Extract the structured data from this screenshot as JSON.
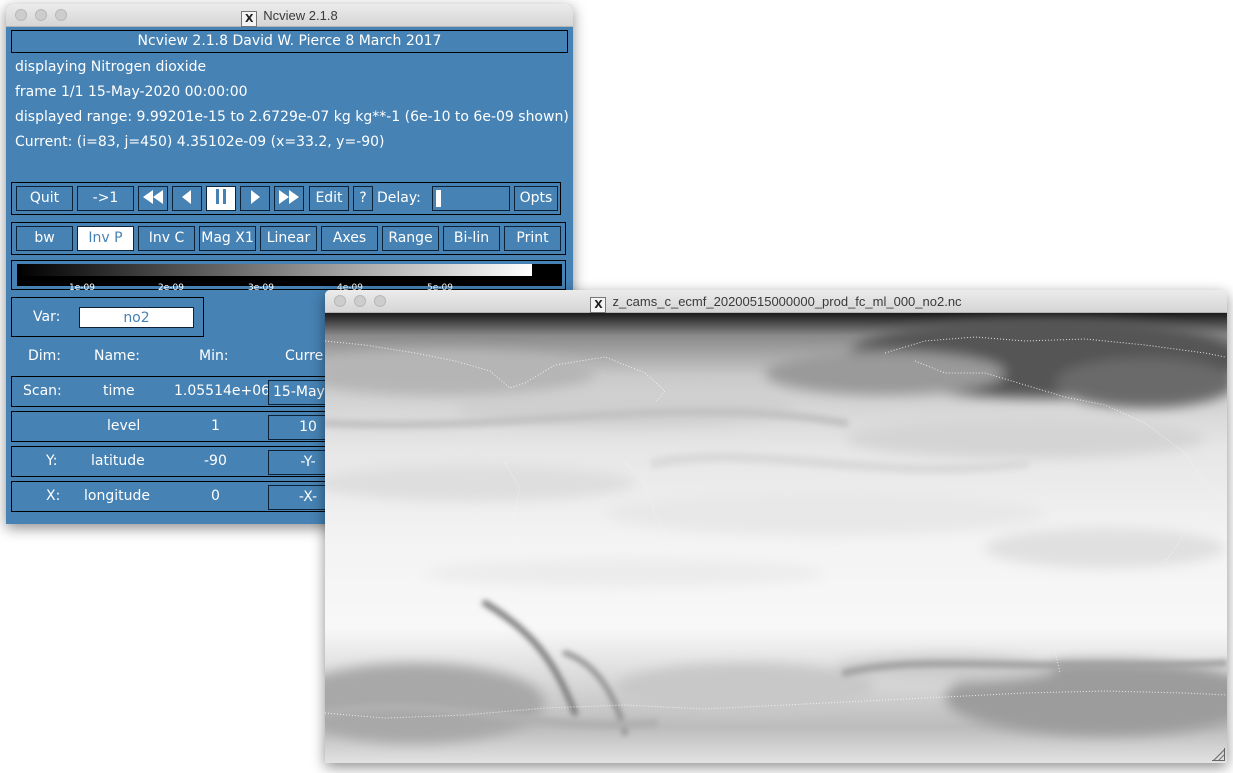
{
  "control_window": {
    "title": "Ncview 2.1.8",
    "banner": "Ncview 2.1.8 David W. Pierce  8 March 2017",
    "info": {
      "displaying": "displaying Nitrogen dioxide",
      "frame": "frame 1/1 15-May-2020 00:00:00",
      "range": "displayed range: 9.99201e-15 to 2.6729e-07 kg kg**-1 (6e-10 to 6e-09 shown)",
      "current": "Current: (i=83, j=450) 4.35102e-09 (x=33.2, y=-90)"
    },
    "buttons_row1": {
      "quit": "Quit",
      "restart": "->1",
      "edit": "Edit",
      "help": "?",
      "delay_label": "Delay:",
      "opts": "Opts"
    },
    "buttons_row2": {
      "bw": "bw",
      "invp": "Inv P",
      "invc": "Inv C",
      "mag": "Mag X1",
      "linear": "Linear",
      "axes": "Axes",
      "range": "Range",
      "bilin": "Bi-lin",
      "print": "Print"
    },
    "colorbar_ticks": [
      "1e-09",
      "2e-09",
      "3e-09",
      "4e-09",
      "5e-09"
    ],
    "var_label": "Var:",
    "var_value": "no2",
    "dim_header": {
      "dim": "Dim:",
      "name": "Name:",
      "min": "Min:",
      "current": "Curre"
    },
    "dims": [
      {
        "dim": "Scan:",
        "name": "time",
        "min": "1.05514e+06",
        "current": "15-May-"
      },
      {
        "dim": "",
        "name": "level",
        "min": "1",
        "current": "10"
      },
      {
        "dim": "Y:",
        "name": "latitude",
        "min": "-90",
        "current": "-Y-"
      },
      {
        "dim": "X:",
        "name": "longitude",
        "min": "0",
        "current": "-X-"
      }
    ]
  },
  "image_window": {
    "title": "z_cams_c_ecmf_20200515000000_prod_fc_ml_000_no2.nc"
  }
}
